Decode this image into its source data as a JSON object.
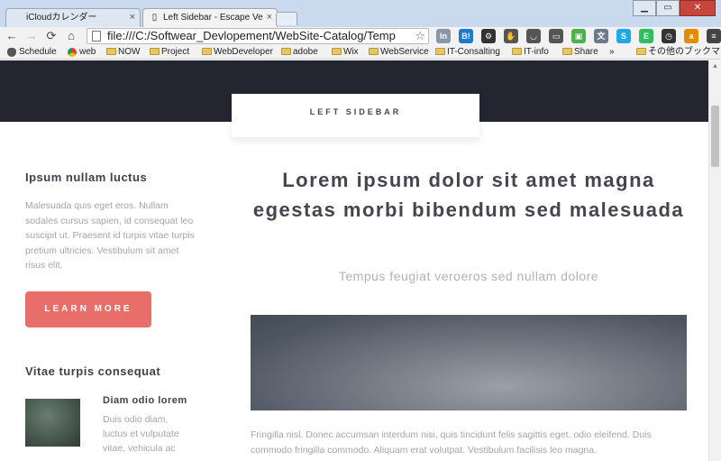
{
  "browser": {
    "tabs": [
      {
        "label": "iCloudカレンダー",
        "icon": "apple-icon"
      },
      {
        "label": "Left Sidebar - Escape Ve",
        "icon": "page-icon"
      }
    ],
    "tab_close": "×",
    "window_buttons": {
      "minimize": "▁",
      "maximize": "▭",
      "close": "✕"
    },
    "nav": {
      "back": "←",
      "forward": "→",
      "reload": "⟳",
      "home": "⌂"
    },
    "url": "file:///C:/Softwear_Devlopement/WebSite-Catalog/Temp",
    "star": "☆",
    "extensions": [
      {
        "icon": "ext-box-icon",
        "label": "In",
        "color": "#8a96a6"
      },
      {
        "icon": "hatena-bookmark-icon",
        "label": "B!",
        "color": "#1a7bcf"
      },
      {
        "icon": "settings-gear-icon",
        "label": "⚙",
        "color": "#333333"
      },
      {
        "icon": "stamp-icon",
        "label": "✋",
        "color": "#555555"
      },
      {
        "icon": "pocket-icon",
        "label": "◡",
        "color": "#555555"
      },
      {
        "icon": "tablet-icon",
        "label": "▭",
        "color": "#555555"
      },
      {
        "icon": "green-app-icon",
        "label": "▣",
        "color": "#4caf50"
      },
      {
        "icon": "translate-icon",
        "label": "文",
        "color": "#6c7a89"
      },
      {
        "icon": "skype-icon",
        "label": "S",
        "color": "#1eaae8"
      },
      {
        "icon": "evernote-icon",
        "label": "E",
        "color": "#2dbe60"
      },
      {
        "icon": "clock-icon",
        "label": "◷",
        "color": "#333333"
      },
      {
        "icon": "amazon-icon",
        "label": "a",
        "color": "#e68a00"
      },
      {
        "icon": "menu-icon",
        "label": "≡",
        "color": "#444444"
      }
    ],
    "bookmarks": [
      {
        "label": "Schedule",
        "type": "apple"
      },
      {
        "label": "web",
        "type": "chrome"
      },
      {
        "label": "NOW",
        "type": "folder"
      },
      {
        "label": "Project",
        "type": "folder"
      },
      {
        "label": "WebDeveloper",
        "type": "folder"
      },
      {
        "label": "adobe",
        "type": "folder"
      },
      {
        "label": "Wix",
        "type": "folder"
      },
      {
        "label": "WebService",
        "type": "folder"
      },
      {
        "label": "IT-Consalting",
        "type": "folder"
      },
      {
        "label": "IT-info",
        "type": "folder"
      },
      {
        "label": "Share",
        "type": "folder"
      }
    ],
    "bookmarks_overflow": "»",
    "other_bookmarks": "その他のブックマーク"
  },
  "page": {
    "header_tab": "LEFT SIDEBAR",
    "sidebar": {
      "section1_title": "Ipsum nullam luctus",
      "section1_text": "Malesuada quis eget eros. Nullam sodales cursus sapien, id consequat leo suscipit ut. Praesent id turpis vitae turpis pretium ultricies. Vestibulum sit amet risus elit.",
      "button": "LEARN MORE",
      "section2_title": "Vitae turpis consequat",
      "item_title": "Diam odio lorem",
      "item_text": "Duis odio diam, luctus et vulputate vitae, vehicula ac"
    },
    "main": {
      "heading": "Lorem ipsum dolor sit amet magna egestas morbi bibendum sed malesuada",
      "subheading": "Tempus feugiat veroeros sed nullam dolore",
      "body": "Fringilla nisl. Donec accumsan interdum nisi, quis tincidunt felis sagittis eget. odio eleifend. Duis commodo fringilla commodo. Aliquam erat volutpat. Vestibulum facilisis leo magna."
    }
  },
  "colors": {
    "hero_bg": "#232631",
    "accent_button": "#e86e6a",
    "heading_text": "#44464f",
    "body_text": "#a3a5aa"
  }
}
